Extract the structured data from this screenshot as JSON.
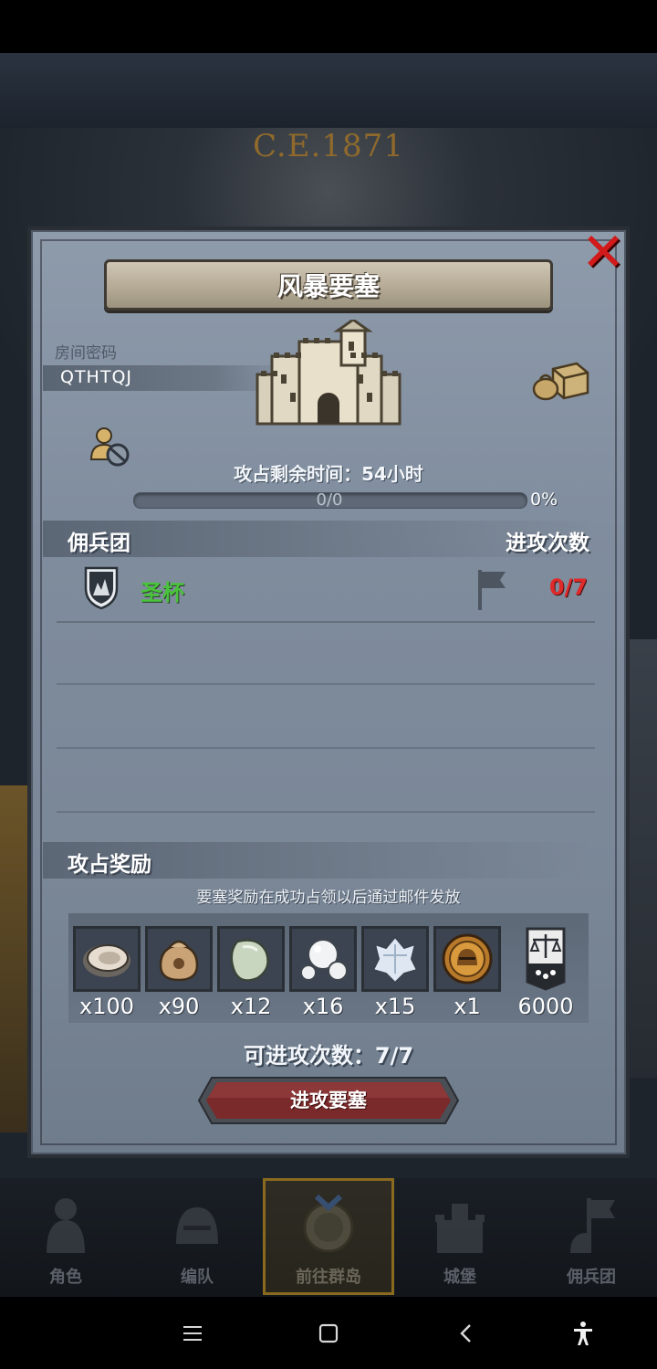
{
  "background": {
    "year_text": "C.E.1871"
  },
  "dialog": {
    "title": "风暴要塞",
    "room_label": "房间密码",
    "room_code": "QTHTQJ",
    "remaining_time": "攻占剩余时间：54小时",
    "progress": {
      "text": "0/0",
      "percent_text": "0%",
      "fraction": 0.0
    },
    "mercenary_section": {
      "left_header": "佣兵团",
      "right_header": "进攻次数",
      "rows": [
        {
          "name": "圣杯",
          "count": "0/7"
        }
      ]
    },
    "reward_section": {
      "header": "攻占奖励",
      "note": "要塞奖励在成功占领以后通过邮件发放",
      "items": [
        {
          "icon": "oyster-icon",
          "qty": "x100"
        },
        {
          "icon": "sack-icon",
          "qty": "x90"
        },
        {
          "icon": "jade-stone-icon",
          "qty": "x12"
        },
        {
          "icon": "pearl-icon",
          "qty": "x16"
        },
        {
          "icon": "crystal-icon",
          "qty": "x15"
        },
        {
          "icon": "knight-medal-icon",
          "qty": "x1"
        },
        {
          "icon": "justice-banner-icon",
          "qty": "6000"
        }
      ]
    },
    "attacks_available": "可进攻次数：7/7",
    "attack_button": "进攻要塞"
  },
  "bottom_nav": {
    "items": [
      {
        "label": "角色",
        "icon": "knight-icon"
      },
      {
        "label": "编队",
        "icon": "helmet-icon"
      },
      {
        "label": "前往群岛",
        "icon": "compass-icon",
        "active": true
      },
      {
        "label": "城堡",
        "icon": "castle-icon"
      },
      {
        "label": "佣兵团",
        "icon": "mercenary-icon"
      }
    ]
  },
  "colors": {
    "panel": "#7f8c9d",
    "close": "#d21a1a",
    "mercenary_name": "#48c43a",
    "attack_count": "#e02a2a",
    "attack_button": "#7a2a2a",
    "nav_active_border": "#8a6a1e"
  }
}
